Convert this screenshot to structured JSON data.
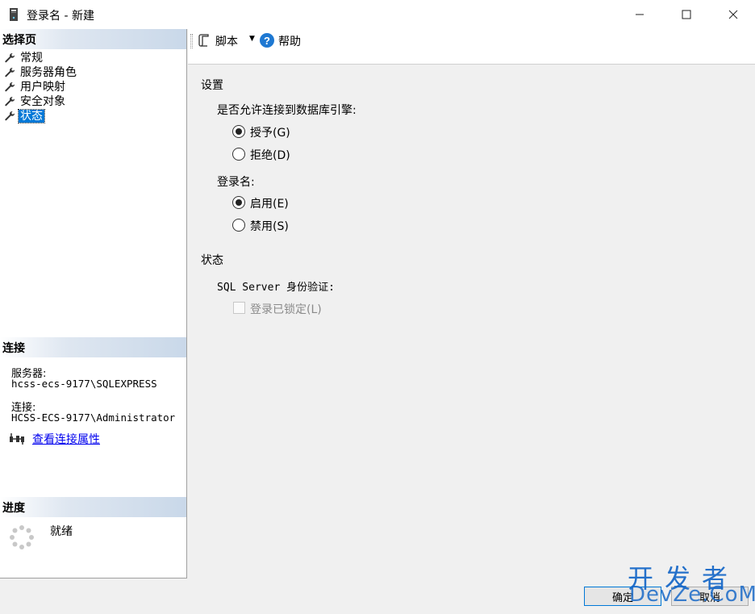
{
  "window": {
    "title": "登录名 - 新建",
    "icon": "server-icon",
    "controls": {
      "minimize": "─",
      "maximize": "☐",
      "close": "✕"
    }
  },
  "left": {
    "select_page": {
      "header": "选择页",
      "items": [
        {
          "label": "常规",
          "icon": "wrench-icon"
        },
        {
          "label": "服务器角色",
          "icon": "wrench-icon"
        },
        {
          "label": "用户映射",
          "icon": "wrench-icon"
        },
        {
          "label": "安全对象",
          "icon": "wrench-icon"
        },
        {
          "label": "状态",
          "icon": "wrench-icon",
          "selected": true
        }
      ]
    },
    "connection": {
      "header": "连接",
      "server_label": "服务器:",
      "server_value": "hcss-ecs-9177\\SQLEXPRESS",
      "conn_label": "连接:",
      "conn_value": "HCSS-ECS-9177\\Administrator",
      "link": "查看连接属性",
      "link_icon": "connection-properties-icon"
    },
    "progress": {
      "header": "进度",
      "status": "就绪",
      "icon": "spinner-icon"
    }
  },
  "toolbar": {
    "script_label": "脚本",
    "script_icon": "script-icon",
    "dropdown_icon": "dropdown-arrow-icon",
    "help_label": "帮助",
    "help_icon": "help-icon"
  },
  "main": {
    "settings_title": "设置",
    "db_engine_question": "是否允许连接到数据库引擎:",
    "grant_label": "授予(G)",
    "deny_label": "拒绝(D)",
    "grant_checked": true,
    "login_title": "登录名:",
    "enable_label": "启用(E)",
    "disable_label": "禁用(S)",
    "enable_checked": true,
    "status_title": "状态",
    "sql_auth_label": "SQL Server 身份验证:",
    "locked_label": "登录已锁定(L)",
    "locked_checked": false
  },
  "buttons": {
    "ok": "确定",
    "cancel": "取消"
  },
  "watermark": {
    "line1": "开发者",
    "line2": "DevZe.CoM"
  },
  "colors": {
    "selection": "#0078d7",
    "header_gradient": "#c9d8e9",
    "link": "#0000ee",
    "watermark": "#1a6ac8"
  }
}
